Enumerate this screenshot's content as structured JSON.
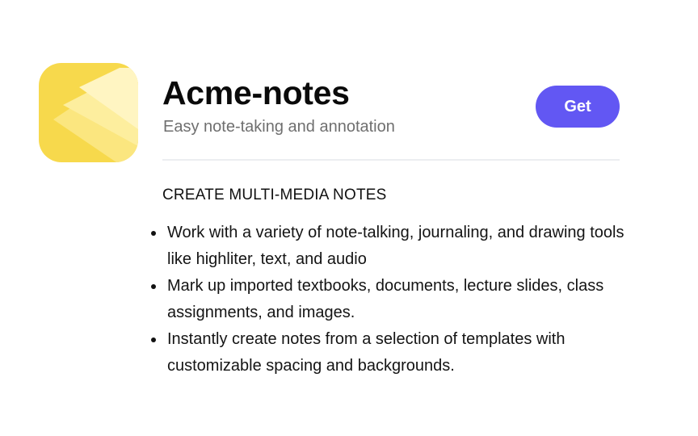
{
  "app": {
    "name": "Acme-notes",
    "subtitle": "Easy note-taking and annotation",
    "get_label": "Get",
    "icon": "stacked-layers-icon"
  },
  "section": {
    "heading": "CREATE MULTI-MEDIA NOTES",
    "features": [
      "Work with a variety of note-talking, journaling, and drawing tools like highliter, text, and audio",
      "Mark up imported textbooks, documents, lecture slides, class assignments, and images.",
      "Instantly create notes from a selection of templates with customizable spacing and backgrounds."
    ]
  },
  "colors": {
    "accent": "#6257f3",
    "icon_yellow": "#f7d94c",
    "divider": "#eceef1"
  }
}
